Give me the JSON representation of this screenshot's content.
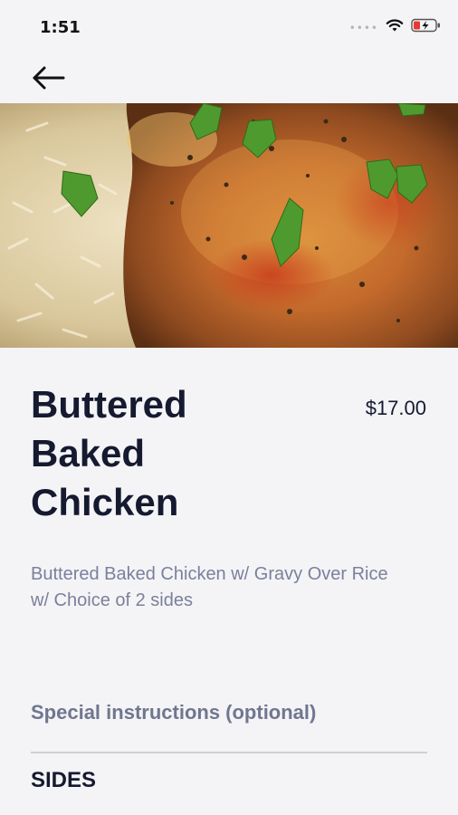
{
  "status_bar": {
    "time": "1:51",
    "signal": "•••• ",
    "icons": [
      "wifi-icon",
      "battery-charging-icon"
    ],
    "battery_color": "#e53935"
  },
  "nav": {
    "back_icon": "arrow-left-icon"
  },
  "item": {
    "title": "Buttered Baked Chicken",
    "price": "$17.00",
    "description": "Buttered Baked Chicken w/ Gravy Over Rice w/ Choice of 2 sides"
  },
  "special_instructions": {
    "label": "Special instructions (optional)"
  },
  "sections": {
    "sides_header": "SIDES"
  },
  "colors": {
    "background": "#f4f4f6",
    "title": "#151a30",
    "muted": "#7b809c",
    "label": "#70768f"
  }
}
